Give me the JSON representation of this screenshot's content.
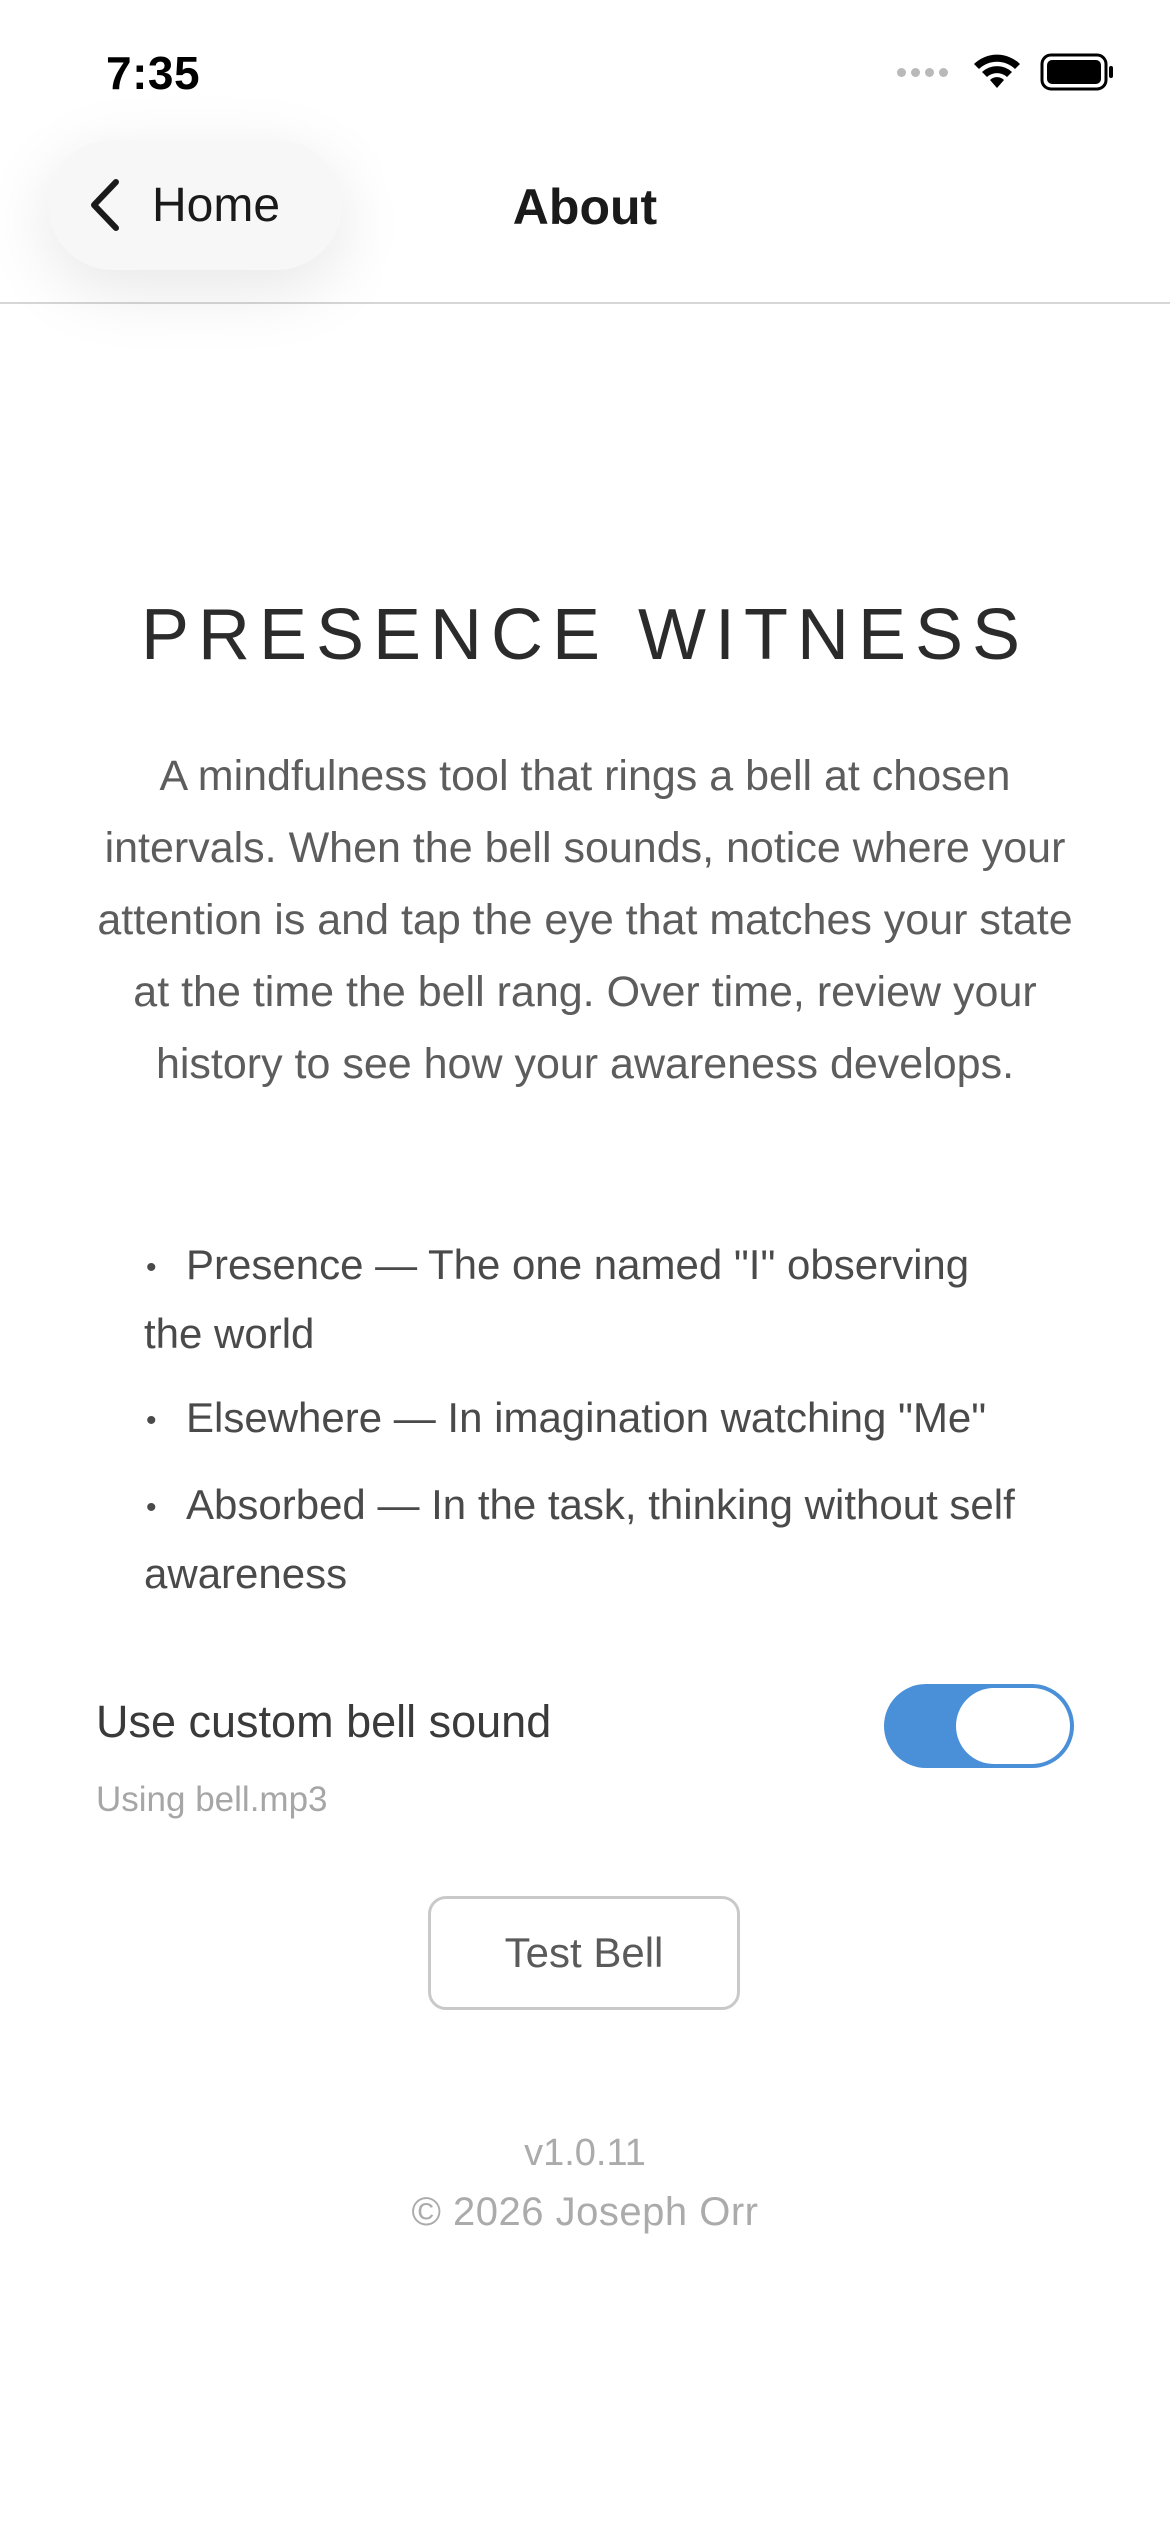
{
  "status_bar": {
    "time": "7:35"
  },
  "nav": {
    "back_label": "Home",
    "title": "About"
  },
  "content": {
    "app_title": "PRESENCE WITNESS",
    "description": "A mindfulness tool that rings a bell at chosen intervals. When the bell sounds, notice where your attention is and tap the eye that matches your state at the time the bell rang. Over time, review your history to see how your awareness develops.",
    "bullets": [
      "Presence — The one named \"I\" observing the world",
      "Elsewhere — In imagination watching \"Me\"",
      "Absorbed — In the task, thinking without self awareness"
    ]
  },
  "settings": {
    "custom_bell_label": "Use custom bell sound",
    "custom_bell_enabled": true,
    "custom_bell_status": "Using bell.mp3"
  },
  "actions": {
    "test_bell_label": "Test Bell"
  },
  "footer": {
    "version": "v1.0.11",
    "copyright": "© 2026 Joseph Orr"
  },
  "colors": {
    "accent": "#4a90d9",
    "text_primary": "#3a3a3a",
    "text_muted": "#ababab"
  },
  "icons": {
    "back": "chevron-left-icon",
    "signal": "cellular-signal-icon",
    "wifi": "wifi-icon",
    "battery": "battery-icon"
  }
}
